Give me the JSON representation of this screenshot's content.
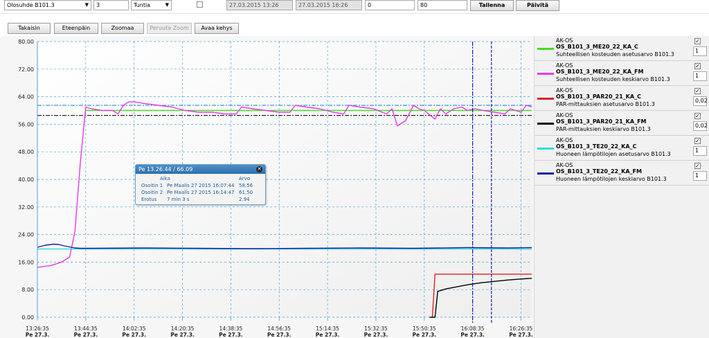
{
  "toolbar": {
    "target_select": "Olosuhde B101.3",
    "period_value": "3",
    "period_unit": "Tuntia",
    "start_time": "27.03.2015 13:26",
    "end_time": "27.03.2015 16:26",
    "y_min": "0",
    "y_max": "80",
    "save_label": "Tallenna",
    "refresh_label": "Päivitä"
  },
  "nav": {
    "back": "Takaisin",
    "forward": "Eteenpäin",
    "zoom": "Zoomaa",
    "cancel_zoom": "Peruuta Zoom",
    "open_frame": "Avaa kehys"
  },
  "tooltip": {
    "header": "Pe 13.26.44 / 66.09",
    "col_time": "Aika",
    "col_value": "Arvo",
    "rows": [
      {
        "label": "Osoitin 1",
        "time": "Pe Maalis 27 2015 16:07:44",
        "value": "58.56"
      },
      {
        "label": "Osoitin 2",
        "time": "Pe Maalis 27 2015 16:14:47",
        "value": "61.50"
      },
      {
        "label": "Erotus",
        "time": "7 min 3 s",
        "value": "2.94"
      }
    ]
  },
  "legend": [
    {
      "group": "AK-OS",
      "name": "OS_B101_3_ME20_22_KA_C",
      "desc": "Suhteellisen kosteuden asetusarvo B101.3",
      "color": "#44dd22",
      "value": "1"
    },
    {
      "group": "AK-OS",
      "name": "OS_B101_3_ME20_22_KA_FM",
      "desc": "Suhteellisen kosteuden keskiarvo B101.3",
      "color": "#e83ae8",
      "value": "1"
    },
    {
      "group": "AK-OS",
      "name": "OS_B101_3_PAR20_21_KA_C",
      "desc": "PAR-mittauksien asetusarvo B101.3",
      "color": "#e02020",
      "value": "0,02"
    },
    {
      "group": "AK-OS",
      "name": "OS_B101_3_PAR20_21_KA_FM",
      "desc": "PAR-mittauksien keskiarvo B101.3",
      "color": "#000000",
      "value": "0,02"
    },
    {
      "group": "AK-OS",
      "name": "OS_B101_3_TE20_22_KA_C",
      "desc": "Huoneen lämpötilojen asetusarvo B101.3",
      "color": "#33dddd",
      "value": "1"
    },
    {
      "group": "AK-OS",
      "name": "OS_B101_3_TE20_22_KA_FM",
      "desc": "Huoneen lämpötilojen keskiarvo B101.3",
      "color": "#1a1aaa",
      "value": "1"
    }
  ],
  "chart_data": {
    "type": "line",
    "ylim": [
      0,
      80
    ],
    "yticks": [
      "80.00",
      "72.00",
      "64.00",
      "56.00",
      "48.00",
      "40.00",
      "32.00",
      "24.00",
      "16.00",
      "8.00",
      "0.00"
    ],
    "xticks": [
      {
        "time": "13:26:35",
        "day": "Pe 27.3."
      },
      {
        "time": "13:44:35",
        "day": "Pe 27.3."
      },
      {
        "time": "14:02:35",
        "day": "Pe 27.3."
      },
      {
        "time": "14:20:35",
        "day": "Pe 27.3."
      },
      {
        "time": "14:38:35",
        "day": "Pe 27.3."
      },
      {
        "time": "14:56:35",
        "day": "Pe 27.3."
      },
      {
        "time": "15:14:35",
        "day": "Pe 27.3."
      },
      {
        "time": "15:32:35",
        "day": "Pe 27.3."
      },
      {
        "time": "15:50:35",
        "day": "Pe 27.3."
      },
      {
        "time": "16:08:35",
        "day": "Pe 27.3."
      },
      {
        "time": "16:26:35",
        "day": "Pe 27.3."
      }
    ],
    "x_unit": "minutes from 13:26:35",
    "x_max": 184,
    "cursors": [
      {
        "x": 162,
        "color": "#0a0aaa",
        "style": "dashdot"
      },
      {
        "x": 169,
        "color": "#0a0aaa",
        "style": "dash"
      }
    ],
    "hlines": [
      {
        "y": 61.5,
        "color": "#1f8fd6",
        "style": "dashdot"
      },
      {
        "y": 58.56,
        "color": "#111111",
        "style": "dashdot"
      }
    ],
    "series": [
      {
        "name": "OS_B101_3_ME20_22_KA_C",
        "color": "#44dd22",
        "x": [
          18,
          184
        ],
        "y": [
          60,
          60
        ]
      },
      {
        "name": "OS_B101_3_ME20_22_KA_FM",
        "color": "#e83ae8",
        "x": [
          0,
          5,
          9,
          12,
          14,
          16,
          18,
          20,
          24,
          28,
          30,
          32,
          34,
          36,
          40,
          45,
          50,
          55,
          60,
          65,
          70,
          74,
          76,
          80,
          85,
          90,
          94,
          96,
          100,
          105,
          110,
          114,
          116,
          120,
          125,
          130,
          132,
          134,
          137,
          140,
          142,
          144,
          148,
          150,
          152,
          155,
          158,
          160,
          163,
          166,
          170,
          174,
          176,
          178,
          180,
          182,
          184
        ],
        "y": [
          14.5,
          15,
          16,
          17.5,
          25,
          45,
          61,
          60.5,
          60,
          60,
          59,
          61.5,
          62.5,
          62.5,
          62,
          61.5,
          61,
          60,
          59.5,
          59.5,
          59,
          59,
          61,
          60.5,
          60,
          59.5,
          59.5,
          61.5,
          61,
          60.5,
          59.5,
          59,
          61.5,
          61,
          60.5,
          59,
          60.5,
          55.5,
          57,
          61.5,
          60.5,
          60,
          57.5,
          60.5,
          59,
          60.5,
          61,
          60,
          60.5,
          60,
          59.5,
          59,
          60.5,
          60,
          59.5,
          61.5,
          61
        ]
      },
      {
        "name": "OS_B101_3_PAR20_21_KA_C",
        "color": "#e02020",
        "x": [
          147,
          148,
          184
        ],
        "y": [
          0,
          12.5,
          12.5
        ]
      },
      {
        "name": "OS_B101_3_PAR20_21_KA_FM",
        "color": "#000000",
        "x": [
          146,
          148,
          149,
          152,
          156,
          160,
          165,
          170,
          175,
          180,
          184
        ],
        "y": [
          0,
          0,
          7.5,
          8.2,
          8.8,
          9.4,
          10,
          10.4,
          10.8,
          11.1,
          11.3
        ]
      },
      {
        "name": "OS_B101_3_TE20_22_KA_C",
        "color": "#33dddd",
        "x": [
          0,
          184
        ],
        "y": [
          19.8,
          19.8
        ]
      },
      {
        "name": "OS_B101_3_TE20_22_KA_FM",
        "color": "#1a1aaa",
        "x": [
          0,
          3,
          6,
          8,
          10,
          12,
          14,
          16,
          20,
          40,
          60,
          80,
          100,
          120,
          140,
          160,
          175,
          184
        ],
        "y": [
          20.3,
          20.9,
          21.2,
          21.1,
          20.7,
          20.4,
          20.1,
          20,
          20,
          20.1,
          20,
          19.9,
          20,
          20.1,
          20,
          20.2,
          20.1,
          20.2
        ]
      }
    ]
  }
}
